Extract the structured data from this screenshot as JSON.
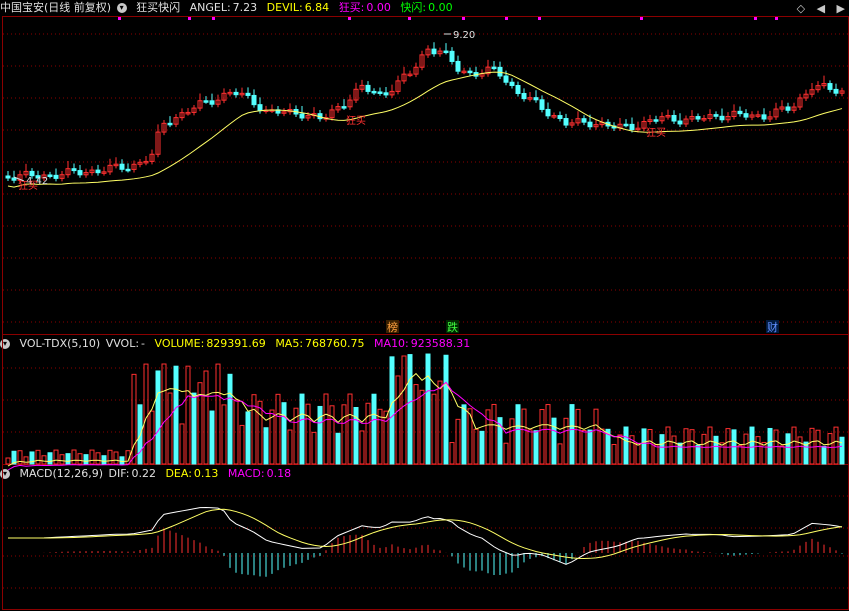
{
  "main_header": {
    "stock": "中国宝安(日线 前复权)",
    "indicator": "狂买快闪",
    "angel_label": "ANGEL:",
    "angel": "7.23",
    "devil_label": "DEVIL:",
    "devil": "6.84",
    "kuangmai_label": "狂买:",
    "kuangmai": "0.00",
    "kuaishan_label": "快闪:",
    "kuaishan": "0.00"
  },
  "toolbar": {
    "diamond_icon": "◇",
    "prev_icon": "◀",
    "next_icon": "▶"
  },
  "chart_annotations": {
    "high_label": "9.20",
    "low_label": "4.42",
    "buy_labels": [
      "狂买",
      "狂买",
      "狂买"
    ],
    "event_tags": [
      "榜",
      "跌",
      "财"
    ]
  },
  "vol_header": {
    "name": "VOL-TDX(5,10)",
    "vvol_label": "VVOL:",
    "vvol": "-",
    "volume_label": "VOLUME:",
    "volume": "829391.69",
    "ma5_label": "MA5:",
    "ma5": "768760.75",
    "ma10_label": "MA10:",
    "ma10": "923588.31"
  },
  "macd_header": {
    "name": "MACD(12,26,9)",
    "dif_label": "DIF:",
    "dif": "0.22",
    "dea_label": "DEA:",
    "dea": "0.13",
    "macd_label": "MACD:",
    "macd": "0.18"
  },
  "colors": {
    "up": "#ff3030",
    "down": "#54ffff",
    "ma_line": "#ffff66",
    "white_line": "#ffffff",
    "magenta": "#ff00ff",
    "grid": "#8b0000",
    "yellow": "#ffff00"
  },
  "chart_data": {
    "type": "candlestick",
    "price_labels": {
      "high": 9.2,
      "low": 4.42
    },
    "indicators": {
      "ANGEL": 7.23,
      "DEVIL": 6.84,
      "VOLUME": 829391.69,
      "MA5": 768760.75,
      "MA10": 923588.31,
      "DIF": 0.22,
      "DEA": 0.13,
      "MACD": 0.18
    }
  }
}
